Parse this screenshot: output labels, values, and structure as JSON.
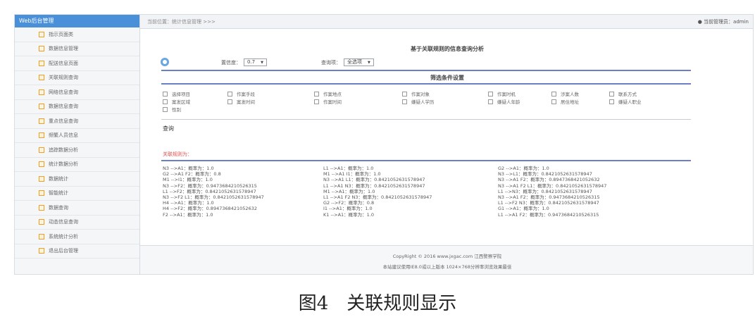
{
  "sidebar": {
    "header": "Web后台管理",
    "items": [
      "指示页面类",
      "数据信息管理",
      "配送信息页面",
      "关联规则查询",
      "网络信息查询",
      "数据信息查询",
      "重点信息查询",
      "频繁人员信息",
      "追踪数据分析",
      "统计数据分析",
      "数据统计",
      "智能统计",
      "数据查询",
      "动态信息查询",
      "系统统计分析",
      "退出后台管理"
    ]
  },
  "topbar": {
    "breadcrumb": "当前位置：统计信息管理 >>>",
    "admin": "● 当前管理员：admin"
  },
  "main": {
    "title": "基于关联规则的信息查询分析",
    "support_label": "置信度：",
    "support_value": "0.7",
    "direction_label": "查询项：",
    "direction_value": "全选项",
    "filter_title": "筛选条件设置",
    "checkboxes": [
      "选择项目",
      "作案手段",
      "作案地点",
      "作案对象",
      "作案时机",
      "涉案人数",
      "联系方式",
      "案发区域",
      "案发时间",
      "作案时间",
      "嫌疑人学历",
      "嫌疑人年龄",
      "居住地址",
      "嫌疑人职业",
      "性别"
    ],
    "query_link": "查询",
    "results_label": "关联规则为："
  },
  "results": {
    "col1": [
      "N3 -->A1：概率为：1.0",
      "G2 -->A1 F2：概率为：0.8",
      "M1 -->I1：概率为：1.0",
      "N3 -->F2：概率为：0.9473684210526315",
      "L1 -->F2：概率为：0.8421052631578947",
      "N3 -->F2 L1：概率为：0.8421052631578947",
      "H4 -->A1：概率为：1.0",
      "H4 -->F2：概率为：0.8947368421052632",
      "F2 -->A1：概率为：1.0"
    ],
    "col2": [
      "L1 -->A1：概率为：1.0",
      "M1 -->A1 I1：概率为：1.0",
      "N3 -->A1 L1：概率为：0.8421052631578947",
      "L1 -->A1 N3：概率为：0.8421052631578947",
      "M1 -->A1：概率为：1.0",
      "L1 -->A1 F2 N3：概率为：0.8421052631578947",
      "G2 -->F2：概率为：0.8",
      "I1 -->A1：概率为：1.0",
      "K1 -->A1：概率为：1.0"
    ],
    "col3": [
      "G2 -->A1：概率为：1.0",
      "N3 -->L1：概率为：0.8421052631578947",
      "N3 -->A1 F2：概率为：0.8947368421052632",
      "N3 -->A1 F2 L1：概率为：0.8421052631578947",
      "L1 -->N3：概率为：0.8421052631578947",
      "N3 -->A1 F2：概率为：0.9473684210526315",
      "L1 -->F2 N3：概率为：0.8421052631578947",
      "G1 -->A1：概率为：1.0",
      "L1 -->A1 F2：概率为：0.9473684210526315"
    ]
  },
  "footer": {
    "copyright": "CopyRight © 2016 www.jxgac.com 江西警察学院",
    "note": "本站建议使用IE8.0或以上版本 1024×768分辨率浏览效果最佳"
  },
  "caption": "图4　关联规则显示",
  "colors": {
    "sidebar_header": "#4a90d8",
    "accent_line": "#6a7fc4",
    "results_label": "#e05050",
    "sidebar_icon": "#f0a020"
  }
}
